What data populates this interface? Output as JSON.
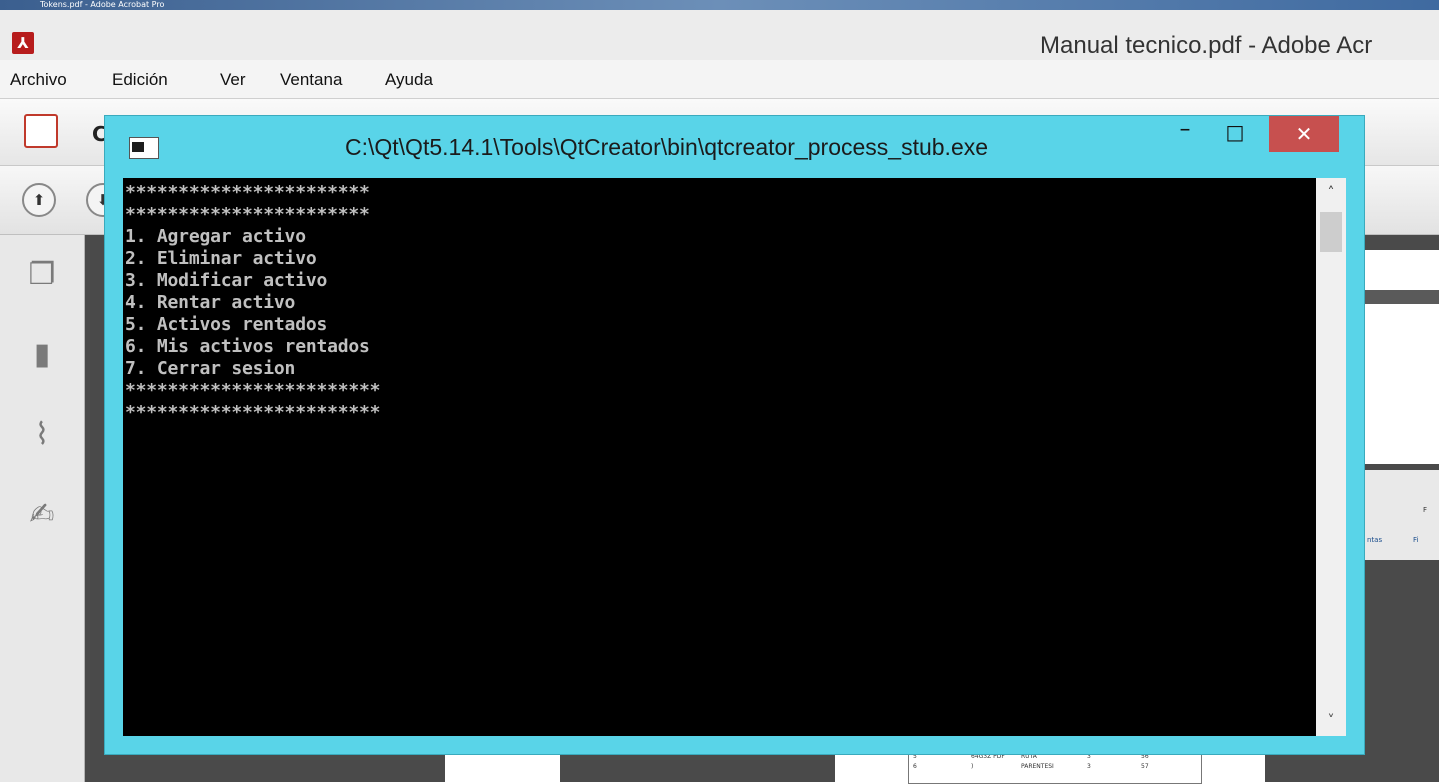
{
  "background_app": {
    "ghost_title": "Tokens.pdf - Adobe Acrobat Pro",
    "window_title": "Manual tecnico.pdf - Adobe Acr",
    "menu": [
      "Archivo",
      "Edición",
      "Ver",
      "Ventana",
      "Ayuda"
    ],
    "toolbar_partial_label": "C",
    "doc_table": {
      "row1": [
        "5",
        "64G3Z PDF",
        "RUTA",
        "3",
        "56"
      ],
      "row2": [
        "6",
        ")",
        "PARENTESI",
        "3",
        "57"
      ]
    },
    "partial_labels": [
      "F",
      "ntas",
      "Fi"
    ]
  },
  "console": {
    "title": "C:\\Qt\\Qt5.14.1\\Tools\\QtCreator\\bin\\qtcreator_process_stub.exe",
    "lines": [
      "***********************",
      "***********************",
      "1. Agregar activo",
      "2. Eliminar activo",
      "3. Modificar activo",
      "4. Rentar activo",
      "5. Activos rentados",
      "6. Mis activos rentados",
      "7. Cerrar sesion",
      "************************",
      "************************"
    ],
    "buttons": {
      "minimize": "–",
      "maximize": "□",
      "close": "✕"
    },
    "scroll": {
      "up": "˄",
      "down": "˅"
    }
  },
  "colors": {
    "console_frame": "#59d4e8",
    "close_button": "#c7504f",
    "console_text": "#c0c0c0",
    "console_bg": "#000000"
  }
}
